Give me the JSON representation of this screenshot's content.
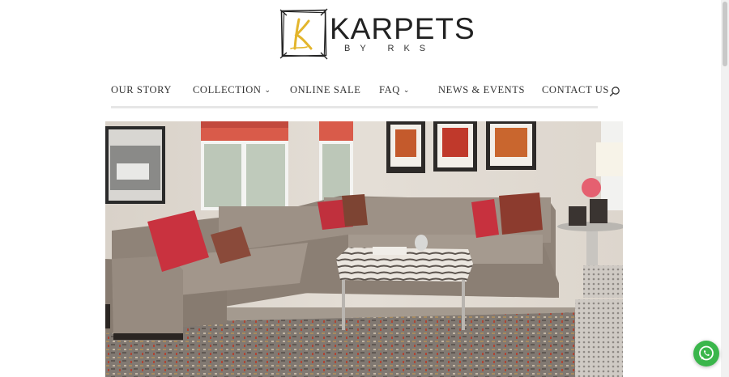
{
  "brand": {
    "name": "KARPETS",
    "sub": "BY RKS",
    "mark_letter": "K",
    "gold": "#e3b52c"
  },
  "nav": {
    "items": [
      {
        "label": "OUR STORY",
        "has_dropdown": false
      },
      {
        "label": "COLLECTION",
        "has_dropdown": true
      },
      {
        "label": "ONLINE SALE",
        "has_dropdown": false
      },
      {
        "label": "FAQ",
        "has_dropdown": true
      },
      {
        "label": "NEWS & EVENTS",
        "has_dropdown": false
      },
      {
        "label": "CONTACT US",
        "has_dropdown": false
      }
    ],
    "search_icon": "search-icon",
    "dropdown_icon": "chevron-down-icon"
  },
  "hero": {
    "image": "living-room-sectional-rug-photo"
  },
  "whatsapp": {
    "icon": "whatsapp-icon",
    "color": "#3ab64b"
  }
}
